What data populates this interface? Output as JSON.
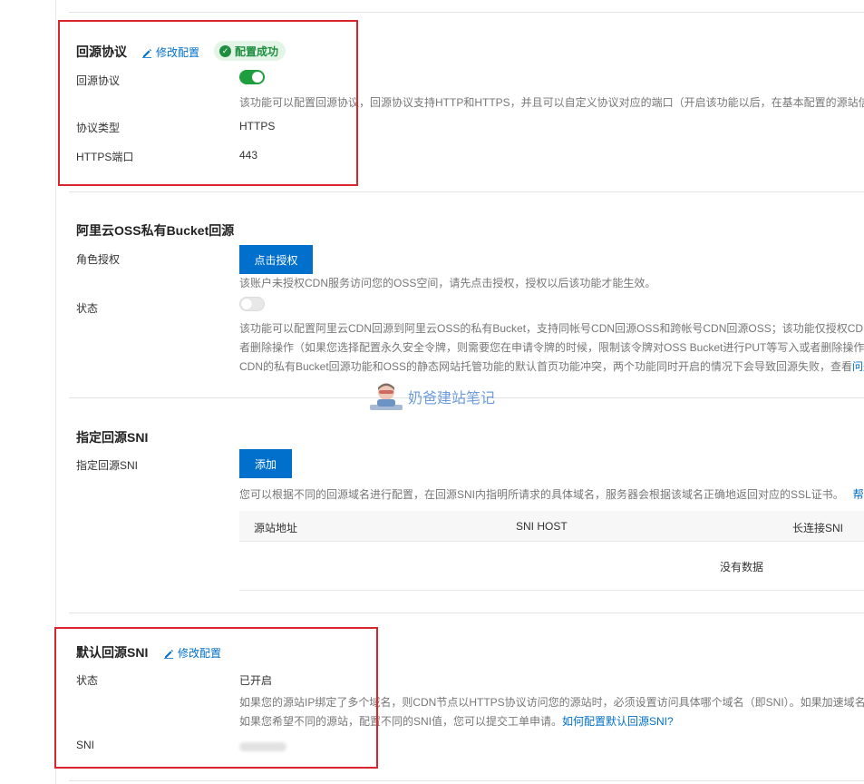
{
  "origin_protocol": {
    "title": "回源协议",
    "edit_label": "修改配置",
    "status_badge": "配置成功",
    "toggle_label": "回源协议",
    "toggle_on": true,
    "help_text": "该功能可以配置回源协议，回源协议支持HTTP和HTTPS，并且可以自定义协议对应的端口（开启该功能以后，在基本配置的源站信息",
    "type_label": "协议类型",
    "type_value": "HTTPS",
    "port_label": "HTTPS端口",
    "port_value": "443"
  },
  "oss_private_bucket": {
    "title": "阿里云OSS私有Bucket回源",
    "role_label": "角色授权",
    "authorize_button": "点击授权",
    "role_help": "该账户未授权CDN服务访问您的OSS空间，请先点击授权，授权以后该功能才能生效。",
    "status_label": "状态",
    "toggle_on": false,
    "help_line1": "该功能可以配置阿里云CDN回源到阿里云OSS的私有Bucket，支持同帐号CDN回源OSS和跨帐号CDN回源OSS；该功能仅授权CDN对",
    "help_line2": "者删除操作（如果您选择配置永久安全令牌，则需要您在申请令牌的时候，限制该令牌对OSS Bucket进行PUT等写入或者删除操作的",
    "help_line3": "CDN的私有Bucket回源功能和OSS的静态网站托管功能的默认首页功能冲突，两个功能同时开启的情况下会导致回源失败，查看",
    "help_line3_link": "问题"
  },
  "specified_sni": {
    "title": "指定回源SNI",
    "label": "指定回源SNI",
    "add_button": "添加",
    "help_text": "您可以根据不同的回源域名进行配置，在回源SNI内指明所请求的具体域名，服务器会根据该域名正确地返回对应的SSL证书。",
    "help_link": "帮助",
    "columns": [
      "源站地址",
      "SNI HOST",
      "长连接SNI"
    ],
    "empty_text": "没有数据"
  },
  "default_sni": {
    "title": "默认回源SNI",
    "edit_label": "修改配置",
    "status_label": "状态",
    "status_value": "已开启",
    "help_line1": "如果您的源站IP绑定了多个域名，则CDN节点以HTTPS协议访问您的源站时，必须设置访问具体哪个域名（即SNI）。如果加速域名",
    "help_line2": "如果您希望不同的源站，配置不同的SNI值，您可以提交工单申请。",
    "help_link": "如何配置默认回源SNI?",
    "sni_label": "SNI"
  },
  "watermark": {
    "text": "奶爸建站笔记"
  },
  "colors": {
    "primary": "#0070cc",
    "success": "#1e8e3e",
    "highlight_box": "#d9262c"
  }
}
